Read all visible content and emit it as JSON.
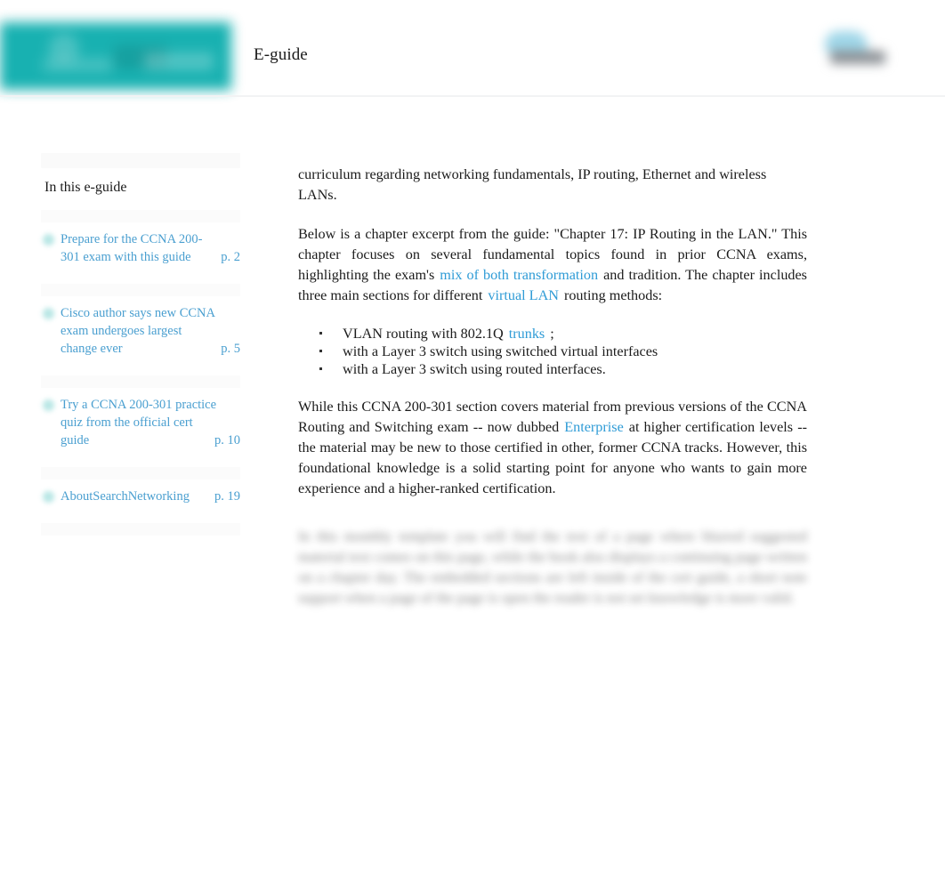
{
  "header": {
    "eguide_label": "E-guide",
    "brand_logo_icon": "techtarget-logo-blurred",
    "sponsor_logo_icon": "sponsor-cloud-logo-blurred"
  },
  "sidebar": {
    "heading": "In this e-guide",
    "items": [
      {
        "icon": "teal-bullet-icon",
        "title_line1": "Prepare for the CCNA 200-",
        "title_line2": "301 exam with this guide",
        "title_line3": "",
        "page": "p. 2"
      },
      {
        "icon": "teal-bullet-icon",
        "title_line1": "Cisco author says new CCNA",
        "title_line2": "exam undergoes largest",
        "title_line3": "change ever",
        "page": "p. 5"
      },
      {
        "icon": "teal-bullet-icon",
        "title_line1": "Try a CCNA 200-301 practice",
        "title_line2": "quiz from the official cert",
        "title_line3": "guide",
        "page": "p. 10"
      },
      {
        "icon": "teal-bullet-icon",
        "title_line1": "AboutSearchNetworking",
        "title_line2": "",
        "title_line3": "",
        "page": "p. 19"
      }
    ]
  },
  "content": {
    "paragraph1": "curriculum regarding networking fundamentals, IP routing, Ethernet and wireless LANs.",
    "paragraph2_a": "Below is a chapter excerpt from the guide: \"Chapter 17: IP Routing in the LAN.\" This chapter focuses on several fundamental topics found in prior CCNA exams, highlighting the exam's",
    "paragraph2_link1": "mix of both transformation",
    "paragraph2_b": "and tradition. The chapter includes three main sections for different",
    "paragraph2_link2": "virtual LAN",
    "paragraph2_c": "routing methods:",
    "list": [
      {
        "text_before": "VLAN routing with 802.1Q",
        "link": "trunks",
        "text_after": ";"
      },
      {
        "text_before": "with a Layer 3 switch using switched virtual interfaces",
        "link": "",
        "text_after": ""
      },
      {
        "text_before": "with a Layer 3 switch using routed interfaces.",
        "link": "",
        "text_after": ""
      }
    ],
    "paragraph3_a": "While this CCNA 200-301 section covers material from previous versions of the CCNA Routing and Switching exam -- now dubbed",
    "paragraph3_link": "Enterprise",
    "paragraph3_b": "at higher certification levels -- the material may be new to those certified in other, former CCNA tracks. However, this foundational knowledge is a solid starting point for anyone who wants to gain more experience and a higher-ranked certification.",
    "blurred_paragraph": "In this monthly template you will find the text of a page where blurred suggested material text comes on this page, while the book also displays a continuing page written on a chapter day. The embedded sections are left inside of the cert guide, a short note support when a page of the page is open the reader is not set knowledge is more valid."
  },
  "colors": {
    "brand_teal": "#11afaf",
    "link_blue": "#2e9bd6",
    "sidebar_link_blue": "#4a9fd0",
    "text_dark": "#1b1b1b"
  }
}
